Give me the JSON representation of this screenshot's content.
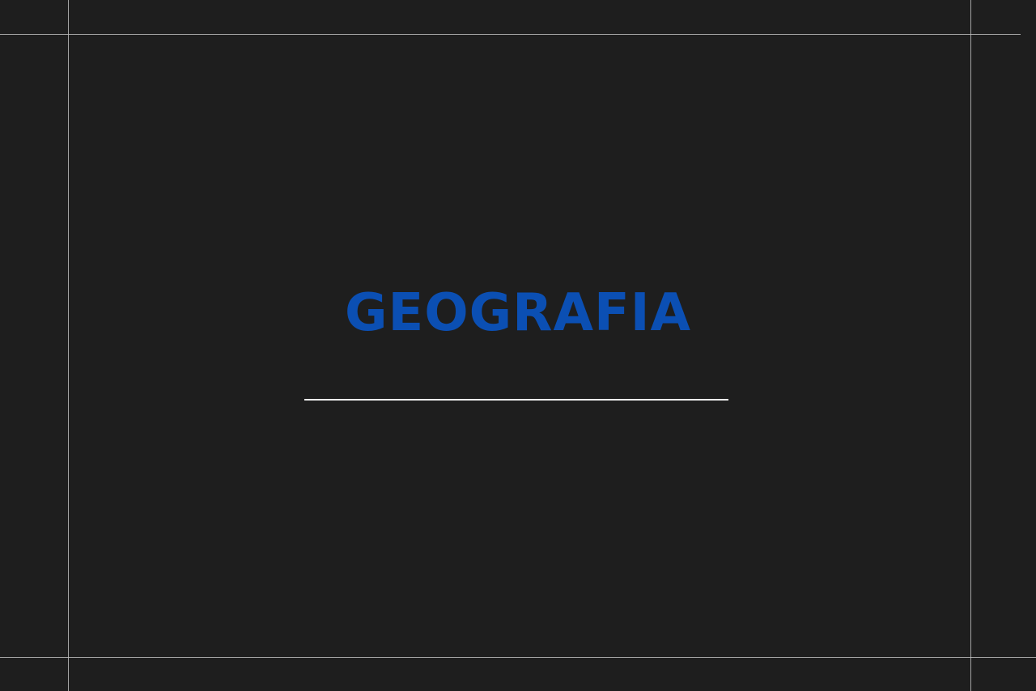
{
  "colors": {
    "background": "#1e1e1e",
    "title": "#0b4fb3",
    "divider": "#f2f2f2",
    "guides": "#bdbdbd"
  },
  "slide": {
    "title": "GEOGRAFIA"
  }
}
